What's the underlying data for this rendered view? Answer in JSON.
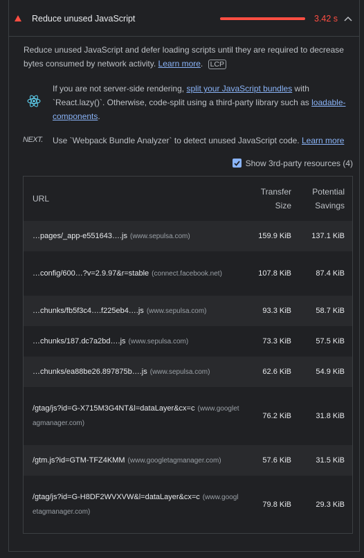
{
  "audit": {
    "title": "Reduce unused JavaScript",
    "time": "3.42 s",
    "description": "Reduce unused JavaScript and defer loading scripts until they are required to decrease bytes consumed by network activity.",
    "learn_more": "Learn more",
    "badge": "LCP"
  },
  "colors": {
    "fail": "#ff4e42",
    "link": "#8ab4f8",
    "bg": "#202124"
  },
  "react_tip": {
    "pre": "If you are not server-side rendering,",
    "link1": "split your JavaScript bundles",
    "mid": "with `React.lazy()`. Otherwise, code-split using a third-party library such as",
    "link2": "loadable-components",
    "post": "."
  },
  "next_tip": {
    "icon_text": "NEXT.",
    "text": "Use `Webpack Bundle Analyzer` to detect unused JavaScript code.",
    "link": "Learn more"
  },
  "third_party": {
    "label": "Show 3rd-party resources (4)",
    "checked": true
  },
  "table": {
    "headers": {
      "url": "URL",
      "size_l1": "Transfer",
      "size_l2": "Size",
      "save_l1": "Potential",
      "save_l2": "Savings"
    },
    "rows": [
      {
        "url": "…pages/_app-e551643….js",
        "host": "(www.sepulsa.com)",
        "size": "159.9 KiB",
        "savings": "137.1 KiB"
      },
      {
        "url": "…config/600…?v=2.9.97&r=stable",
        "host": "(connect.facebook.net)",
        "size": "107.8 KiB",
        "savings": "87.4 KiB"
      },
      {
        "url": "…chunks/fb5f3c4….f225eb4….js",
        "host": "(www.sepulsa.com)",
        "size": "93.3 KiB",
        "savings": "58.7 KiB"
      },
      {
        "url": "…chunks/187.dc7a2bd….js",
        "host": "(www.sepulsa.com)",
        "size": "73.3 KiB",
        "savings": "57.5 KiB"
      },
      {
        "url": "…chunks/ea88be26.897875b….js",
        "host": "(www.sepulsa.com)",
        "size": "62.6 KiB",
        "savings": "54.9 KiB"
      },
      {
        "url": "/gtag/js?id=G-X715M3G4NT&l=dataLayer&cx=c",
        "host": "(www.googletagmanager.com)",
        "size": "76.2 KiB",
        "savings": "31.8 KiB"
      },
      {
        "url": "/gtm.js?id=GTM-TFZ4KMM",
        "host": "(www.googletagmanager.com)",
        "size": "57.6 KiB",
        "savings": "31.5 KiB"
      },
      {
        "url": "/gtag/js?id=G-H8DF2WVXVW&l=dataLayer&cx=c",
        "host": "(www.googletagmanager.com)",
        "size": "79.8 KiB",
        "savings": "29.3 KiB"
      }
    ]
  }
}
